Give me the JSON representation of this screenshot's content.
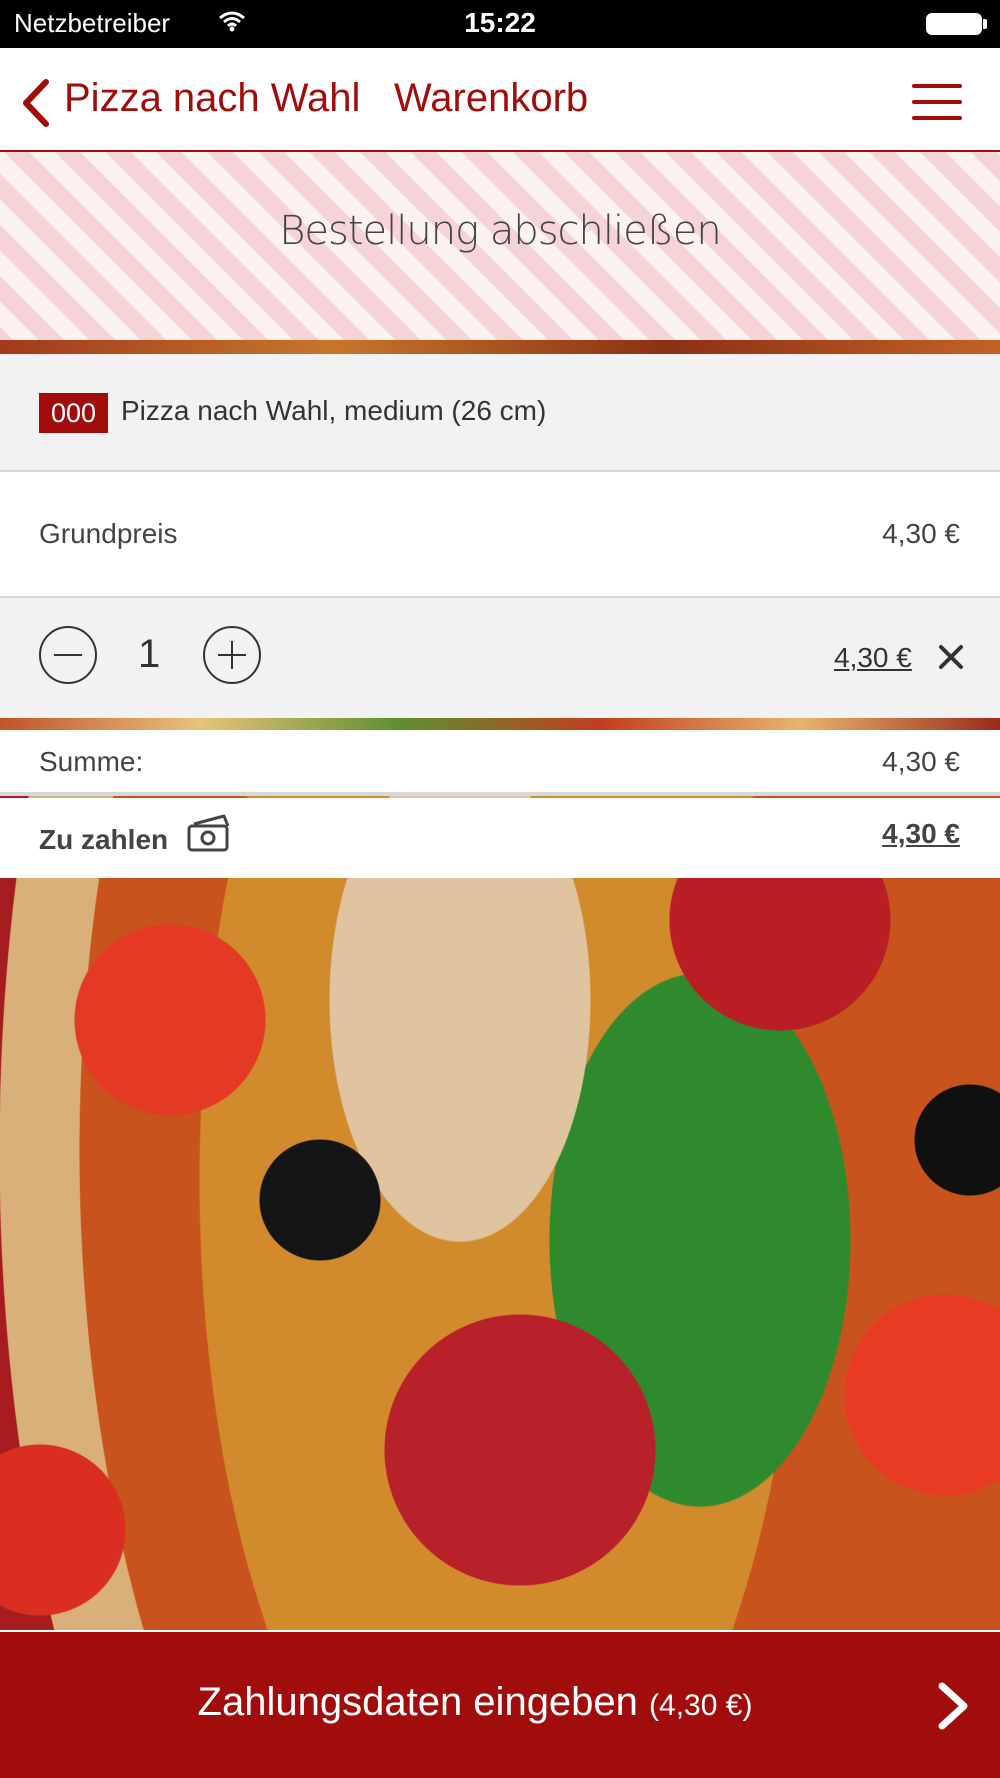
{
  "status_bar": {
    "carrier": "Netzbetreiber",
    "time": "15:22"
  },
  "nav": {
    "back_label": "Pizza nach Wahl",
    "title": "Warenkorb",
    "accent_color": "#a10c0c"
  },
  "hero": {
    "heading": "Bestellung abschließen"
  },
  "cart": {
    "item": {
      "code": "000",
      "name": "Pizza nach Wahl, medium (26 cm)"
    },
    "base_price": {
      "label": "Grundpreis",
      "value": "4,30 €"
    },
    "quantity": "1",
    "line_total": "4,30 €"
  },
  "totals": {
    "sum_label": "Summe:",
    "sum_value": "4,30 €",
    "pay_label": "Zu zahlen",
    "pay_value": "4,30 €"
  },
  "footer": {
    "cta_label": "Zahlungsdaten eingeben",
    "cta_amount": "(4,30 €)"
  }
}
